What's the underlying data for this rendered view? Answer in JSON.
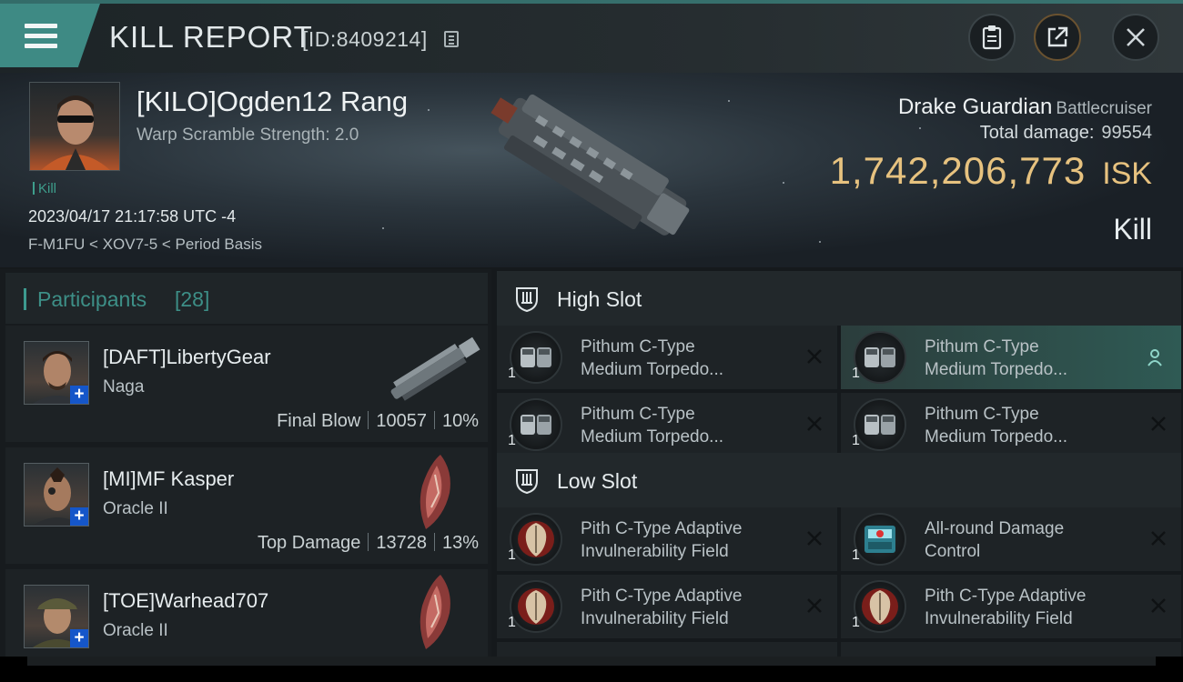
{
  "header": {
    "title": "KILL REPORT",
    "report_id": "[ID:8409214]",
    "icons": [
      "menu-icon",
      "copy-icon",
      "clipboard-icon",
      "share-icon",
      "close-icon"
    ]
  },
  "victim": {
    "name": "[KILO]Ogden12 Rang",
    "warp_scramble": "Warp Scramble Strength: 2.0",
    "tag": "Kill",
    "timestamp": "2023/04/17 21:17:58 UTC -4",
    "location": "F-M1FU < XOV7-5 < Period Basis",
    "ship_name": "Drake Guardian",
    "ship_class": "Battlecruiser",
    "total_damage_label": "Total damage:",
    "total_damage": "99554",
    "isk_value": "1,742,206,773",
    "isk_unit": "ISK",
    "result": "Kill"
  },
  "participants": {
    "title": "Participants",
    "count": "[28]",
    "items": [
      {
        "name": "[DAFT]LibertyGear",
        "ship": "Naga",
        "role": "Final Blow",
        "damage": "10057",
        "percent": "10%"
      },
      {
        "name": "[MI]MF Kasper",
        "ship": "Oracle II",
        "role": "Top Damage",
        "damage": "13728",
        "percent": "13%"
      },
      {
        "name": "[TOE]Warhead707",
        "ship": "Oracle II"
      }
    ]
  },
  "high_slot": {
    "title": "High Slot",
    "modules": [
      {
        "line1": "Pithum C-Type",
        "line2": "Medium Torpedo...",
        "qty": "1"
      },
      {
        "line1": "Pithum C-Type",
        "line2": "Medium Torpedo...",
        "qty": "1"
      },
      {
        "line1": "Pithum C-Type",
        "line2": "Medium Torpedo...",
        "qty": "1"
      },
      {
        "line1": "Pithum C-Type",
        "line2": "Medium Torpedo...",
        "qty": "1"
      }
    ]
  },
  "low_slot": {
    "title": "Low Slot",
    "modules": [
      {
        "line1": "Pith C-Type Adaptive",
        "line2": "Invulnerability Field",
        "qty": "1"
      },
      {
        "line1": "All-round Damage",
        "line2": "Control",
        "qty": "1"
      },
      {
        "line1": "Pith C-Type Adaptive",
        "line2": "Invulnerability Field",
        "qty": "1"
      },
      {
        "line1": "Pith C-Type Adaptive",
        "line2": "Invulnerability Field",
        "qty": "1"
      }
    ]
  },
  "colors": {
    "accent_teal": "#3e8a84",
    "isk_gold": "#e7c27f",
    "plus_blue": "#1556c9"
  }
}
